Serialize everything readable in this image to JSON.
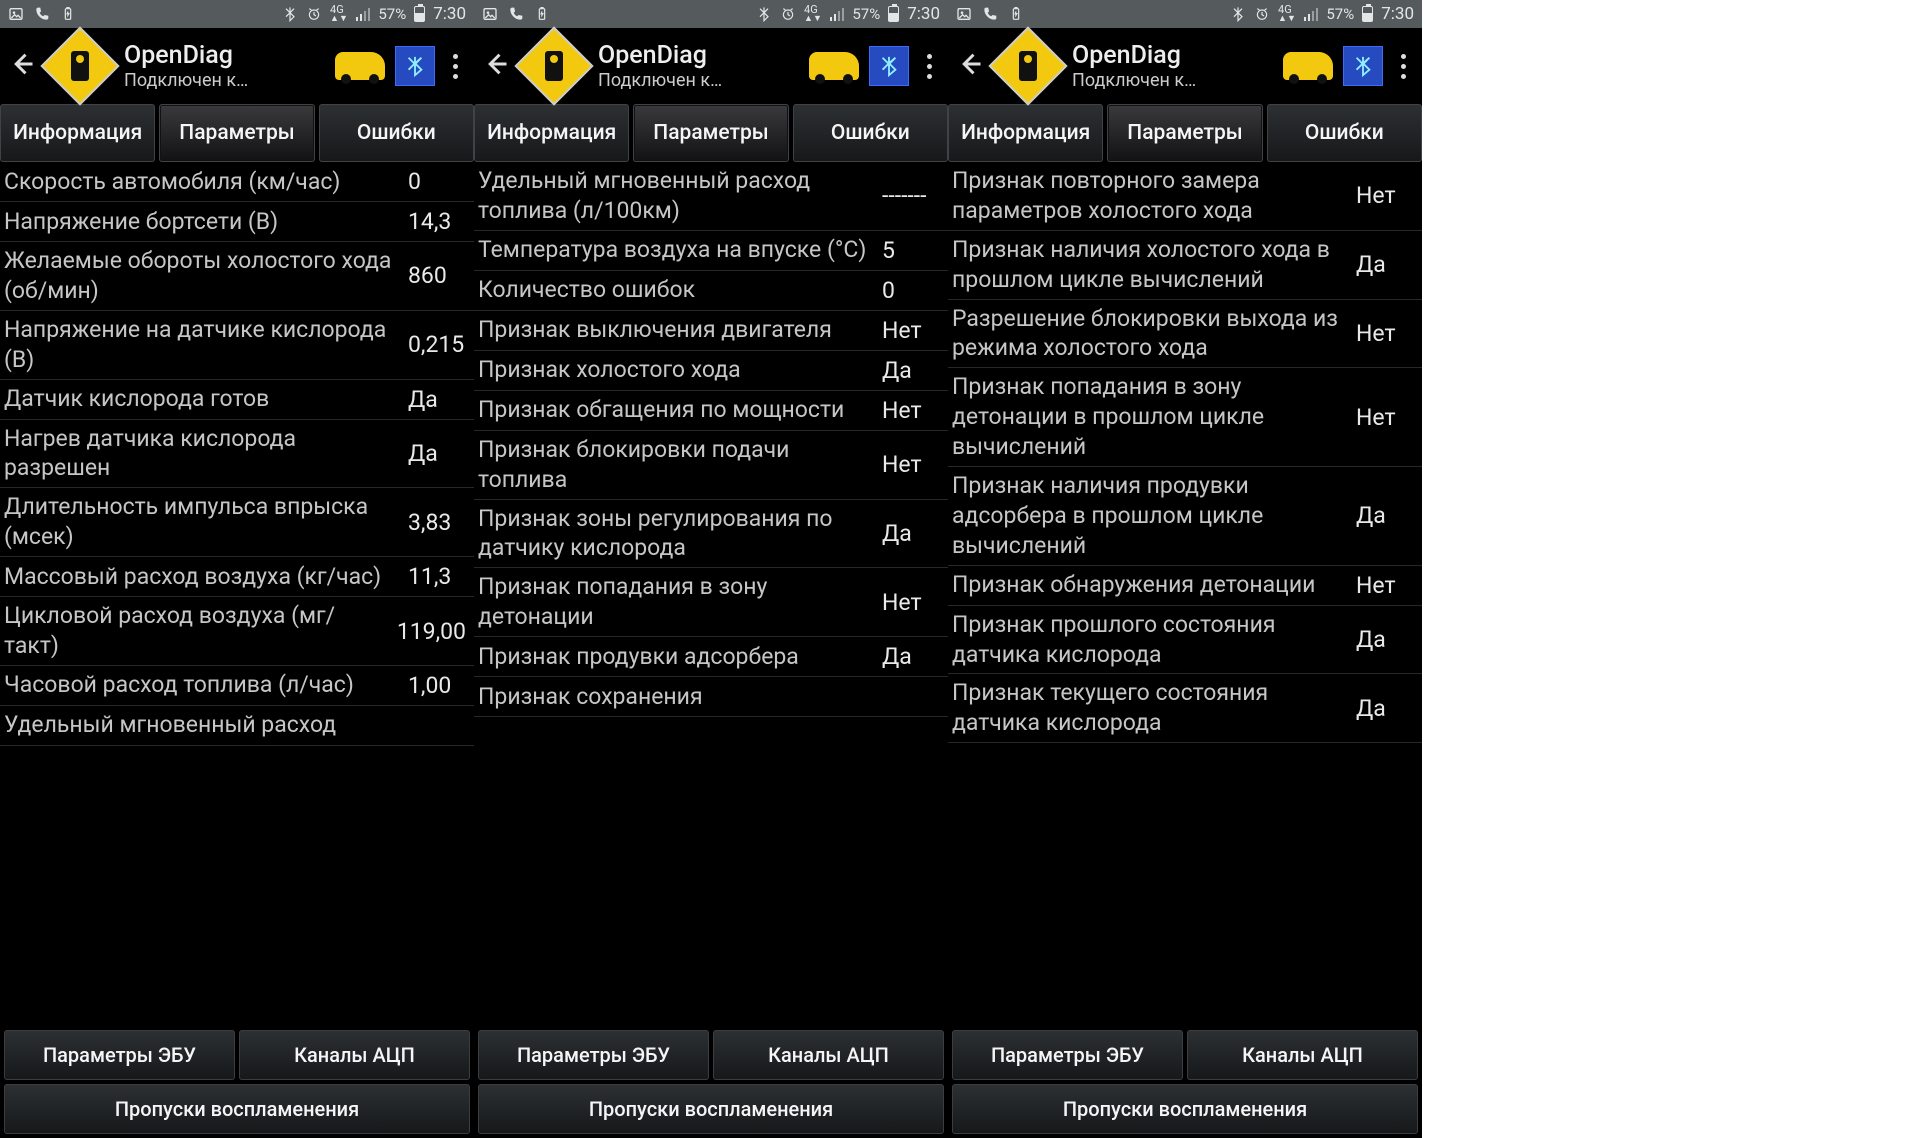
{
  "statusbar": {
    "network": "4G",
    "battery": "57%",
    "time": "7:30"
  },
  "app": {
    "title": "OpenDiag",
    "subtitle": "Подключен к…"
  },
  "tabs": {
    "info": "Информация",
    "params": "Параметры",
    "errors": "Ошибки"
  },
  "bottom": {
    "ecu": "Параметры ЭБУ",
    "adc": "Каналы АЦП",
    "misfire": "Пропуски воспламенения"
  },
  "screens": [
    {
      "rows": [
        {
          "label": "Скорость автомобиля (км/час)",
          "value": "0"
        },
        {
          "label": "Напряжение бортсети (В)",
          "value": "14,3"
        },
        {
          "label": "Желаемые обороты холостого хода (об/мин)",
          "value": "860"
        },
        {
          "label": "Напряжение на датчике кислорода (В)",
          "value": "0,215"
        },
        {
          "label": "Датчик кислорода готов",
          "value": "Да"
        },
        {
          "label": "Нагрев датчика кислорода разрешен",
          "value": "Да"
        },
        {
          "label": "Длительность импульса впрыска (мсек)",
          "value": "3,83"
        },
        {
          "label": "Массовый расход воздуха (кг/час)",
          "value": "11,3"
        },
        {
          "label": "Цикловой расход воздуха (мг/такт)",
          "value": "119,00"
        },
        {
          "label": "Часовой расход топлива (л/час)",
          "value": "1,00"
        },
        {
          "label": "Удельный мгновенный расход",
          "value": ""
        }
      ]
    },
    {
      "rows": [
        {
          "label": "Удельный мгновенный расход топлива (л/100км)",
          "value": "-------"
        },
        {
          "label": "Температура воздуха на впуске (°C)",
          "value": "5"
        },
        {
          "label": "Количество ошибок",
          "value": "0"
        },
        {
          "label": "Признак выключения двигателя",
          "value": "Нет"
        },
        {
          "label": "Признак холостого хода",
          "value": "Да"
        },
        {
          "label": "Признак обгащения по мощности",
          "value": "Нет"
        },
        {
          "label": "Признак блокировки подачи топлива",
          "value": "Нет"
        },
        {
          "label": "Признак зоны регулирования по датчику кислорода",
          "value": "Да"
        },
        {
          "label": "Признак попадания в зону детонации",
          "value": "Нет"
        },
        {
          "label": "Признак продувки адсорбера",
          "value": "Да"
        },
        {
          "label": "Признак сохранения",
          "value": ""
        }
      ]
    },
    {
      "rows": [
        {
          "label": "Признак повторного замера параметров холостого хода",
          "value": "Нет"
        },
        {
          "label": "Признак наличия холостого хода в прошлом цикле вычислений",
          "value": "Да"
        },
        {
          "label": "Разрешение блокировки выхода из режима холостого хода",
          "value": "Нет"
        },
        {
          "label": "Признак попадания в зону детонации в прошлом цикле вычислений",
          "value": "Нет"
        },
        {
          "label": "Признак наличия продувки адсорбера в прошлом цикле вычислений",
          "value": "Да"
        },
        {
          "label": "Признак обнаружения детонации",
          "value": "Нет"
        },
        {
          "label": "Признак прошлого состояния датчика кислорода",
          "value": "Да"
        },
        {
          "label": "Признак текущего состояния датчика кислорода",
          "value": "Да"
        }
      ]
    }
  ]
}
